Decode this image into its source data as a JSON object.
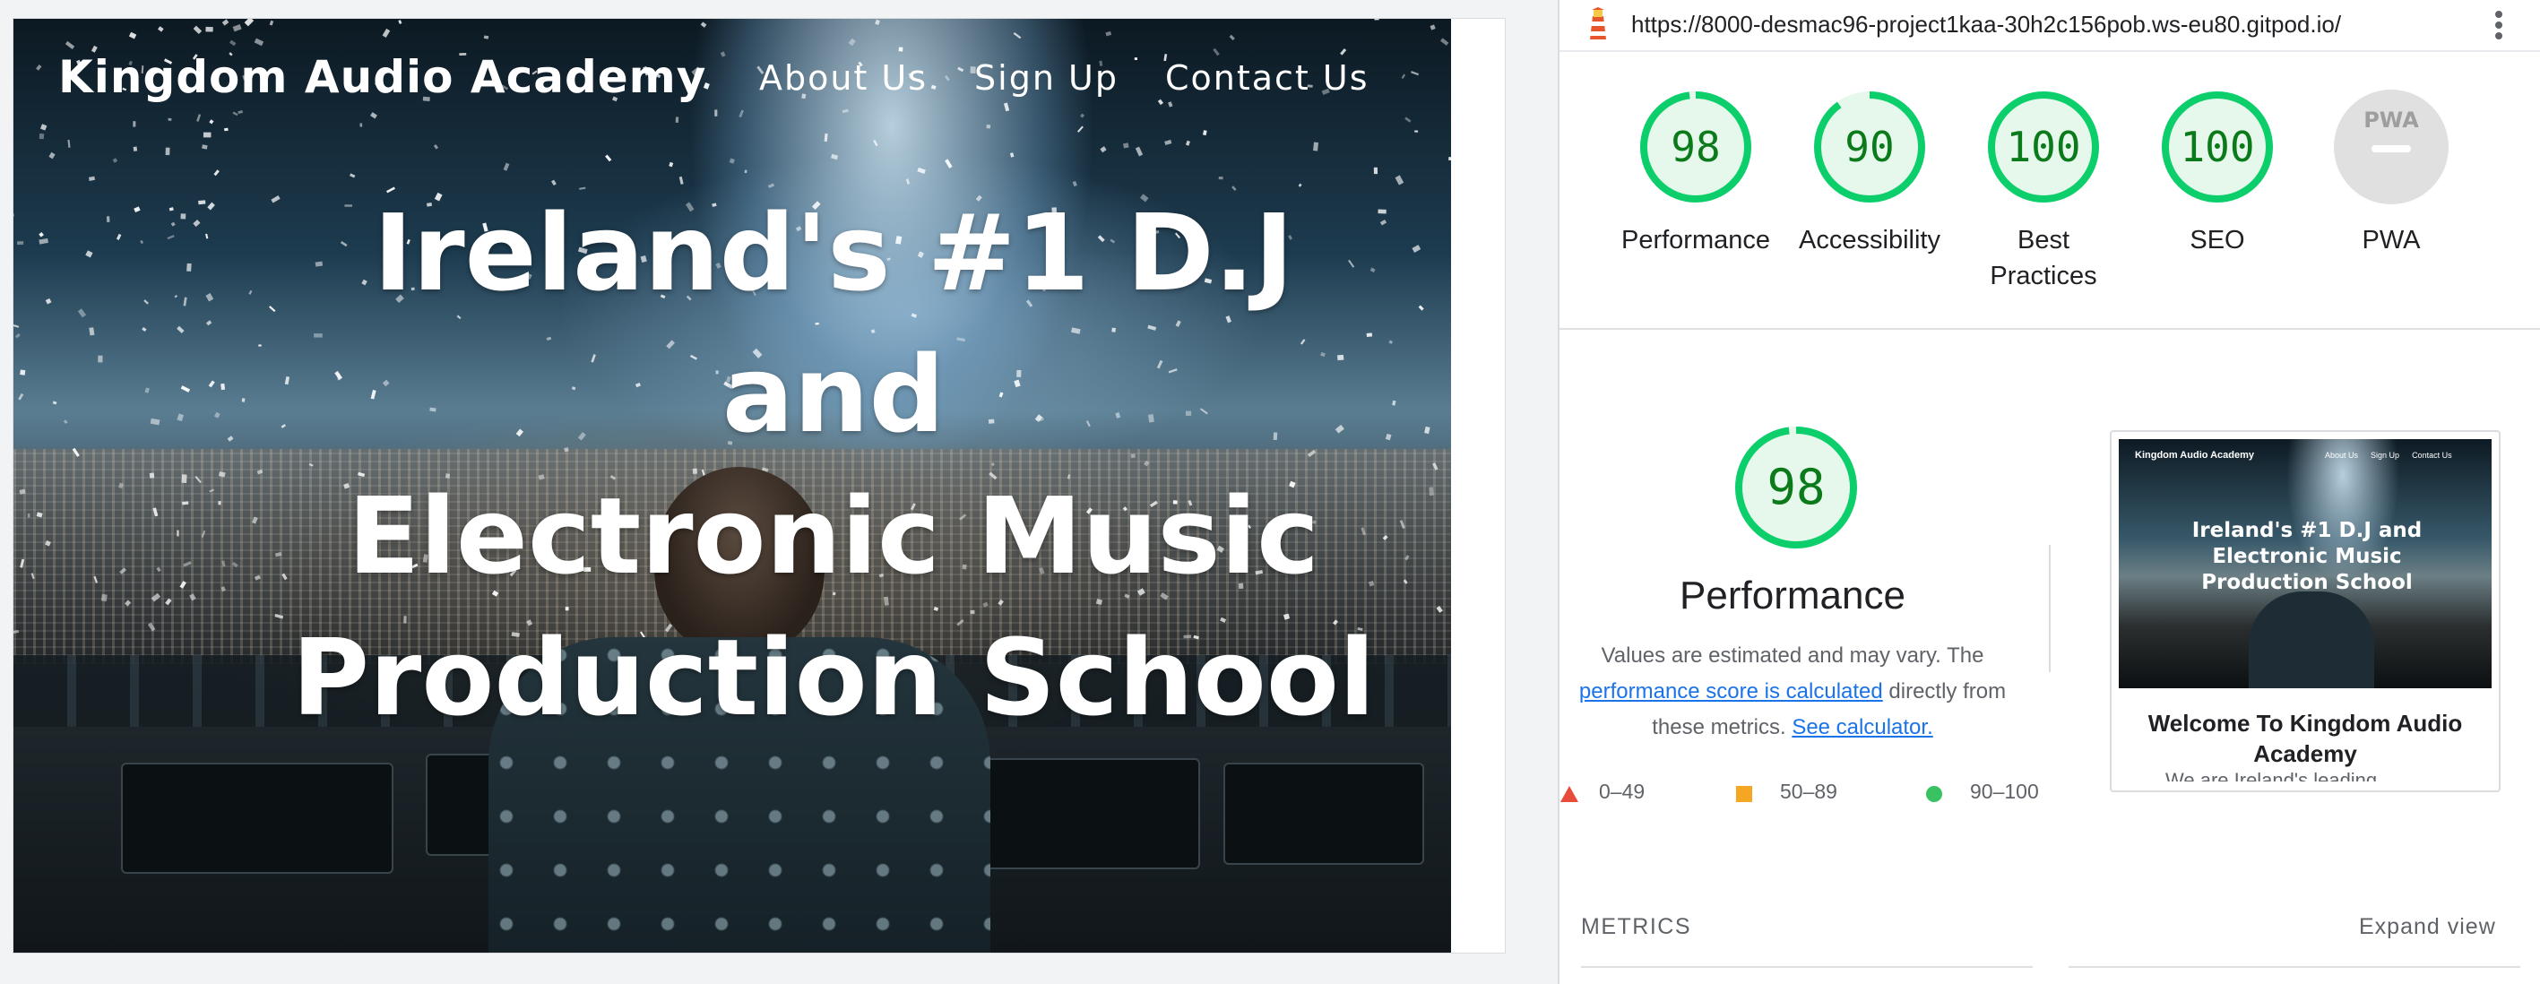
{
  "website": {
    "logo": "Kingdom Audio Academy",
    "nav": [
      "About Us",
      "Sign Up",
      "Contact Us"
    ],
    "hero_title_lines": [
      "Ireland's #1 D.J and",
      "Electronic Music",
      "Production School"
    ]
  },
  "lighthouse": {
    "url": "https://8000-desmac96-project1kaa-30h2c156pob.ws-eu80.gitpod.io/",
    "categories": [
      {
        "label": "Performance",
        "score": "98",
        "value": 98
      },
      {
        "label": "Accessibility",
        "score": "90",
        "value": 90
      },
      {
        "label": "Best Practices",
        "score": "100",
        "value": 100
      },
      {
        "label": "SEO",
        "score": "100",
        "value": 100
      },
      {
        "label": "PWA",
        "score": "",
        "badge": "PWA"
      }
    ],
    "performance": {
      "score": "98",
      "value": 98,
      "title": "Performance",
      "desc_prefix": "Values are estimated and may vary. The",
      "desc_link1": "performance score is calculated",
      "desc_middle": "directly from these metrics.",
      "desc_link2": "See calculator."
    },
    "legend": [
      {
        "range": "0–49",
        "shape": "triangle",
        "color": "#e74c3c"
      },
      {
        "range": "50–89",
        "shape": "square",
        "color": "#f5a623"
      },
      {
        "range": "90–100",
        "shape": "circle",
        "color": "#38c261"
      }
    ],
    "thumbnail": {
      "logo": "Kingdom Audio Academy",
      "nav": [
        "About Us",
        "Sign Up",
        "Contact Us"
      ],
      "title": "Ireland's #1 D.J and Electronic Music Production School",
      "caption": "Welcome To Kingdom Audio Academy",
      "cut_text": "We are Ireland's leading provider of"
    },
    "metrics_label": "METRICS",
    "expand_view": "Expand view",
    "colors": {
      "pass": "#0cce6b",
      "pass_text": "#0b7a1a",
      "pass_bg": "#e6f7ec",
      "na": "#e0e0e0"
    }
  }
}
